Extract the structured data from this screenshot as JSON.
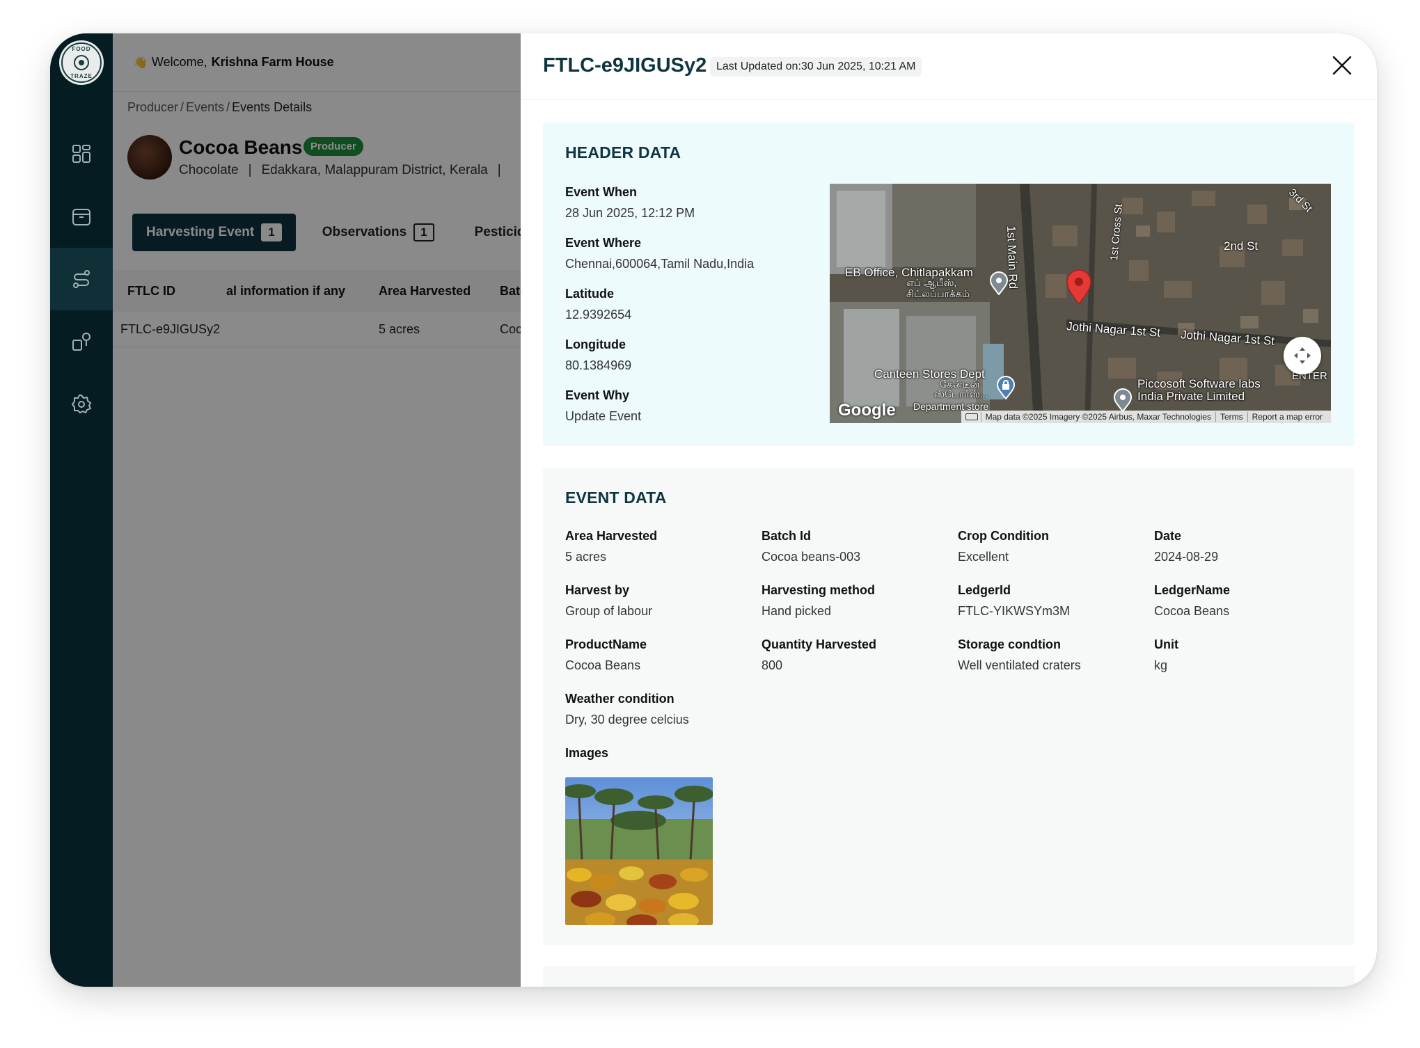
{
  "topbar": {
    "welcome": "Welcome,",
    "farm_name": "Krishna Farm House"
  },
  "breadcrumb": [
    "Producer",
    "Events",
    "Events Details"
  ],
  "product": {
    "name": "Cocoa Beans",
    "badge": "Producer",
    "category": "Chocolate",
    "location": "Edakkara, Malappuram District, Kerala"
  },
  "tabs": [
    {
      "label": "Harvesting Event",
      "count": "1"
    },
    {
      "label": "Observations",
      "count": "1"
    },
    {
      "label": "Pesticide E"
    }
  ],
  "table": {
    "headers": [
      "FTLC ID",
      "al information if any",
      "Area Harvested",
      "Batc"
    ],
    "row": [
      "FTLC-e9JIGUSy2",
      "",
      "5 acres",
      "Coc"
    ]
  },
  "drawer": {
    "title": "FTLC-e9JIGUSy2",
    "last_updated": "Last Updated on:30 Jun 2025, 10:21 AM",
    "header_section": {
      "title": "HEADER DATA",
      "fields": [
        {
          "label": "Event When",
          "value": "28 Jun 2025, 12:12 PM"
        },
        {
          "label": "Event Where",
          "value": "Chennai,600064,Tamil Nadu,India"
        },
        {
          "label": "Latitude",
          "value": "12.9392654"
        },
        {
          "label": "Longitude",
          "value": "80.1384969"
        },
        {
          "label": "Event Why",
          "value": "Update Event"
        }
      ]
    },
    "map": {
      "labels": {
        "eb_office": "EB Office, Chitlapakkam",
        "eb_office_ta": "எப் ஆபீஸ்,",
        "eb_office_ta2": "சிட்லப்பாக்கம்",
        "main_rd": "1st Main Rd",
        "cross_st": "1st Cross St",
        "third_st": "3rd St",
        "second_st": "2nd St",
        "jothi1": "Jothi Nagar 1st St",
        "jothi2": "Jothi Nagar 1st St",
        "canteen": "Canteen Stores Dept",
        "canteen_ta": "கேன்டீன்",
        "canteen_ta2": "ஸ்டோர்ஸ்...",
        "dept_store": "Department store",
        "piccosoft": "Piccosoft Software labs",
        "piccosoft2": "India Private Limited",
        "enter": "ENTER",
        "google": "Google"
      },
      "attribution": [
        "Map data ©2025 Imagery ©2025 Airbus, Maxar Technologies",
        "Terms",
        "Report a map error"
      ]
    },
    "event_section": {
      "title": "EVENT DATA",
      "fields": [
        {
          "label": "Area Harvested",
          "value": "5 acres"
        },
        {
          "label": "Batch Id",
          "value": "Cocoa beans-003"
        },
        {
          "label": "Crop Condition",
          "value": "Excellent"
        },
        {
          "label": "Date",
          "value": "2024-08-29"
        },
        {
          "label": "Harvest by",
          "value": "Group of labour"
        },
        {
          "label": "Harvesting method",
          "value": "Hand picked"
        },
        {
          "label": "LedgerId",
          "value": "FTLC-YIKWSYm3M"
        },
        {
          "label": "LedgerName",
          "value": "Cocoa Beans"
        },
        {
          "label": "ProductName",
          "value": "Cocoa Beans"
        },
        {
          "label": "Quantity Harvested",
          "value": "800"
        },
        {
          "label": "Storage condtion",
          "value": "Well ventilated craters"
        },
        {
          "label": "Unit",
          "value": "kg"
        },
        {
          "label": "Weather condition",
          "value": "Dry, 30 degree celcius"
        }
      ],
      "images_label": "Images"
    }
  },
  "colors": {
    "sidebar": "#051c22",
    "accent": "#0e3540",
    "badge": "#1e8e3e",
    "header_card_bg": "#eefbfd"
  },
  "icons": [
    "dashboard-icon",
    "package-icon",
    "route-icon",
    "product-icon",
    "settings-icon",
    "close-icon",
    "fullscreen-icon",
    "map-pin-icon"
  ]
}
